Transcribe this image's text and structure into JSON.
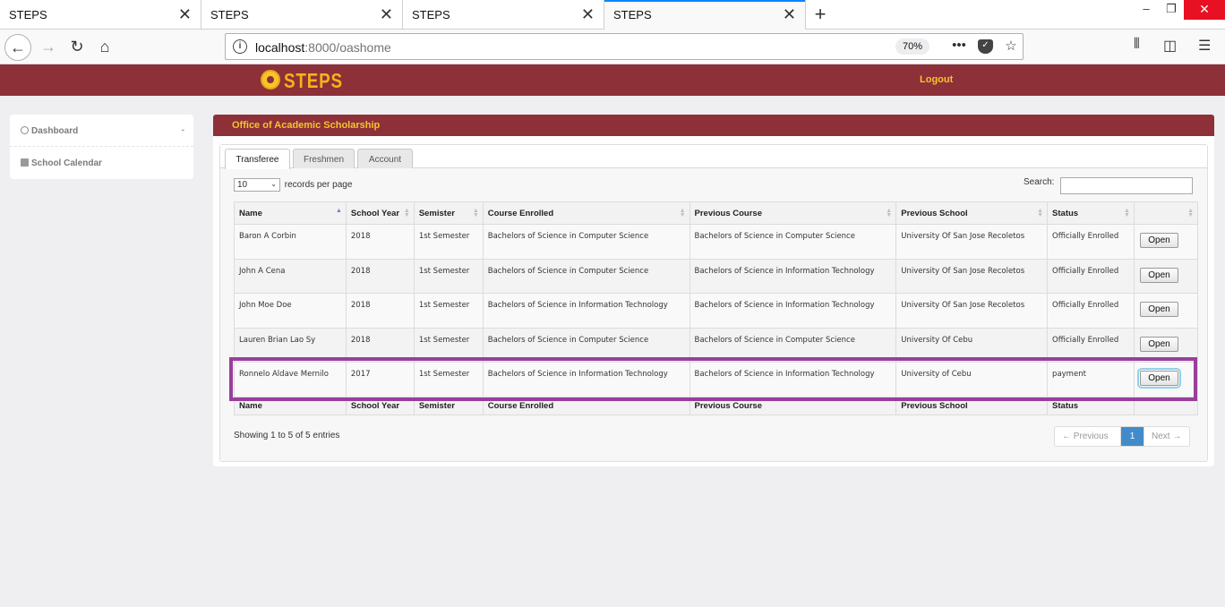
{
  "browser": {
    "tabs": [
      {
        "title": "STEPS"
      },
      {
        "title": "STEPS"
      },
      {
        "title": "STEPS"
      },
      {
        "title": "STEPS"
      }
    ],
    "url_host": "localhost",
    "url_rest": ":8000/oashome",
    "zoom": "70%"
  },
  "app": {
    "logo_text": "STEPS",
    "logout_label": "Logout"
  },
  "sidebar": {
    "items": [
      {
        "label": "Dashboard",
        "icon": "dashboard-icon"
      },
      {
        "label": "School Calendar",
        "icon": "calendar-icon"
      }
    ]
  },
  "panel": {
    "title": "Office of Academic Scholarship",
    "tabs": [
      "Transferee",
      "Freshmen",
      "Account"
    ],
    "length_value": "10",
    "length_suffix": "records per page",
    "search_label": "Search:",
    "search_value": "",
    "columns": [
      "Name",
      "School Year",
      "Semister",
      "Course Enrolled",
      "Previous Course",
      "Previous School",
      "Status"
    ],
    "rows": [
      {
        "name": "Baron A Corbin",
        "year": "2018",
        "semester": "1st Semester",
        "course": "Bachelors of Science in Computer Science",
        "prev_course": "Bachelors of Science in Computer Science",
        "prev_school": "University Of San Jose Recoletos",
        "status": "Officially Enrolled",
        "action": "Open"
      },
      {
        "name": "John A Cena",
        "year": "2018",
        "semester": "1st Semester",
        "course": "Bachelors of Science in Computer Science",
        "prev_course": "Bachelors of Science in Information Technology",
        "prev_school": "University Of San Jose Recoletos",
        "status": "Officially Enrolled",
        "action": "Open"
      },
      {
        "name": "John Moe Doe",
        "year": "2018",
        "semester": "1st Semester",
        "course": "Bachelors of Science in Information Technology",
        "prev_course": "Bachelors of Science in Information Technology",
        "prev_school": "University Of San Jose Recoletos",
        "status": "Officially Enrolled",
        "action": "Open"
      },
      {
        "name": "Lauren Brian Lao Sy",
        "year": "2018",
        "semester": "1st Semester",
        "course": "Bachelors of Science in Computer Science",
        "prev_course": "Bachelors of Science in Computer Science",
        "prev_school": "University Of Cebu",
        "status": "Officially Enrolled",
        "action": "Open"
      },
      {
        "name": "Ronnelo Aldave Mernilo",
        "year": "2017",
        "semester": "1st Semester",
        "course": "Bachelors of Science in Information Technology",
        "prev_course": "Bachelors of Science in Information Technology",
        "prev_school": "University of Cebu",
        "status": "payment",
        "action": "Open"
      }
    ],
    "info": "Showing 1 to 5 of 5 entries",
    "pager": {
      "prev": "← Previous",
      "current": "1",
      "next": "Next →"
    }
  }
}
